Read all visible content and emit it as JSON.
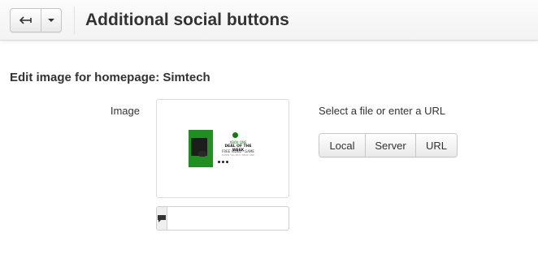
{
  "header": {
    "title": "Additional social buttons",
    "back_icon": "back-arrow-icon",
    "caret_icon": "chevron-down-icon"
  },
  "section": {
    "title": "Edit image for homepage: Simtech"
  },
  "image_field": {
    "label": "Image",
    "preview": {
      "brand_text": "XBOX ONE",
      "headline": "DEAL OF THE WEEK",
      "subline": "FREE VIDEO - GAME",
      "fine_print": "WHEN YOU BUY XBOX ONE",
      "accent_color": "#1f8f1f"
    },
    "alt_text": {
      "icon": "comment-icon",
      "value": "",
      "placeholder": ""
    }
  },
  "source": {
    "prompt": "Select a file or enter a URL",
    "buttons": [
      "Local",
      "Server",
      "URL"
    ]
  }
}
